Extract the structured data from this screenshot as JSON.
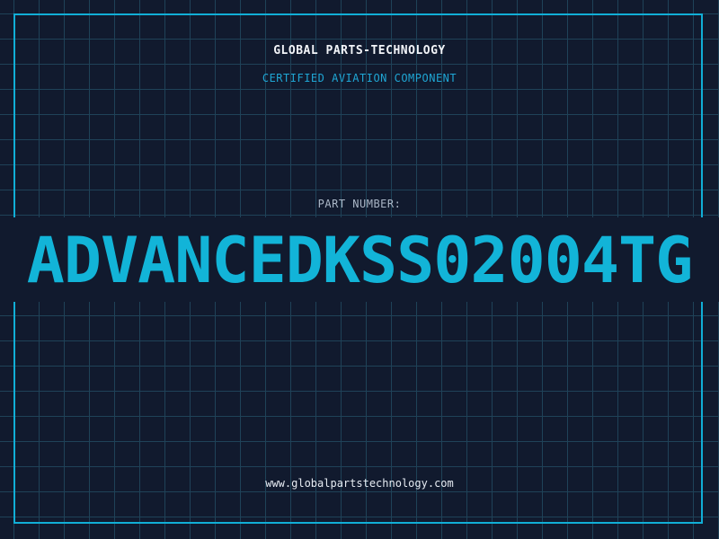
{
  "header": {
    "brand": "GLOBAL PARTS-TECHNOLOGY",
    "subtitle": "CERTIFIED AVIATION COMPONENT"
  },
  "part": {
    "label": "PART NUMBER:",
    "number": "ADVANCEDKSS02004TG"
  },
  "footer": {
    "url": "www.globalpartstechnology.com"
  },
  "colors": {
    "background": "#111a2e",
    "grid": "#1f4258",
    "accent": "#12b4d8",
    "frame": "#11aed6",
    "text": "#f2f4f8"
  }
}
